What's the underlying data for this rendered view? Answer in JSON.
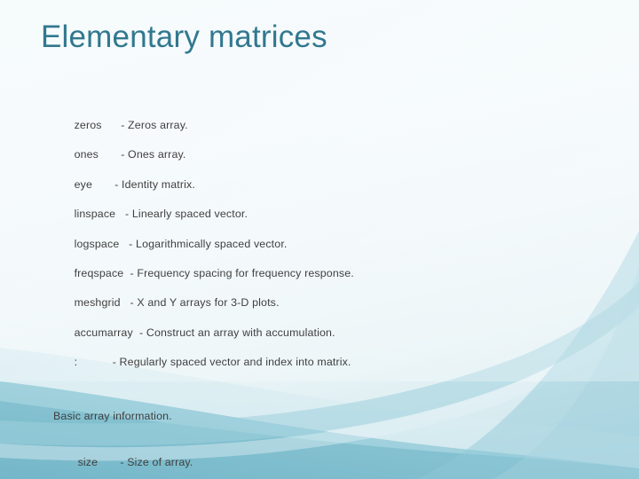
{
  "slide": {
    "title": "Elementary matrices",
    "title_color": "#31788f",
    "body_text_color": "#3f3f3f",
    "background": {
      "top_color": "#f6fbfc",
      "bottom_color": "#74b7c9",
      "accent_color": "#8fc6d6"
    }
  },
  "entries": [
    {
      "name": "zeros",
      "gap": "      ",
      "desc": "- Zeros array."
    },
    {
      "name": "ones",
      "gap": "       ",
      "desc": "- Ones array."
    },
    {
      "name": "eye",
      "gap": "       ",
      "desc": "- Identity matrix."
    },
    {
      "name": "linspace",
      "gap": "   ",
      "desc": "- Linearly spaced vector."
    },
    {
      "name": "logspace",
      "gap": "   ",
      "desc": "- Logarithmically spaced vector."
    },
    {
      "name": "freqspace",
      "gap": "  ",
      "desc": "- Frequency spacing for frequency response."
    },
    {
      "name": "meshgrid",
      "gap": "   ",
      "desc": "- X and Y arrays for 3-D plots."
    },
    {
      "name": "accumarray",
      "gap": "  ",
      "desc": "- Construct an array with accumulation."
    },
    {
      "name": ":",
      "gap": "           ",
      "desc": "- Regularly spaced vector and index into matrix."
    }
  ],
  "section": {
    "heading": "Basic array information.",
    "entry": {
      "name": "size",
      "gap": "       ",
      "desc": "- Size of array."
    }
  }
}
